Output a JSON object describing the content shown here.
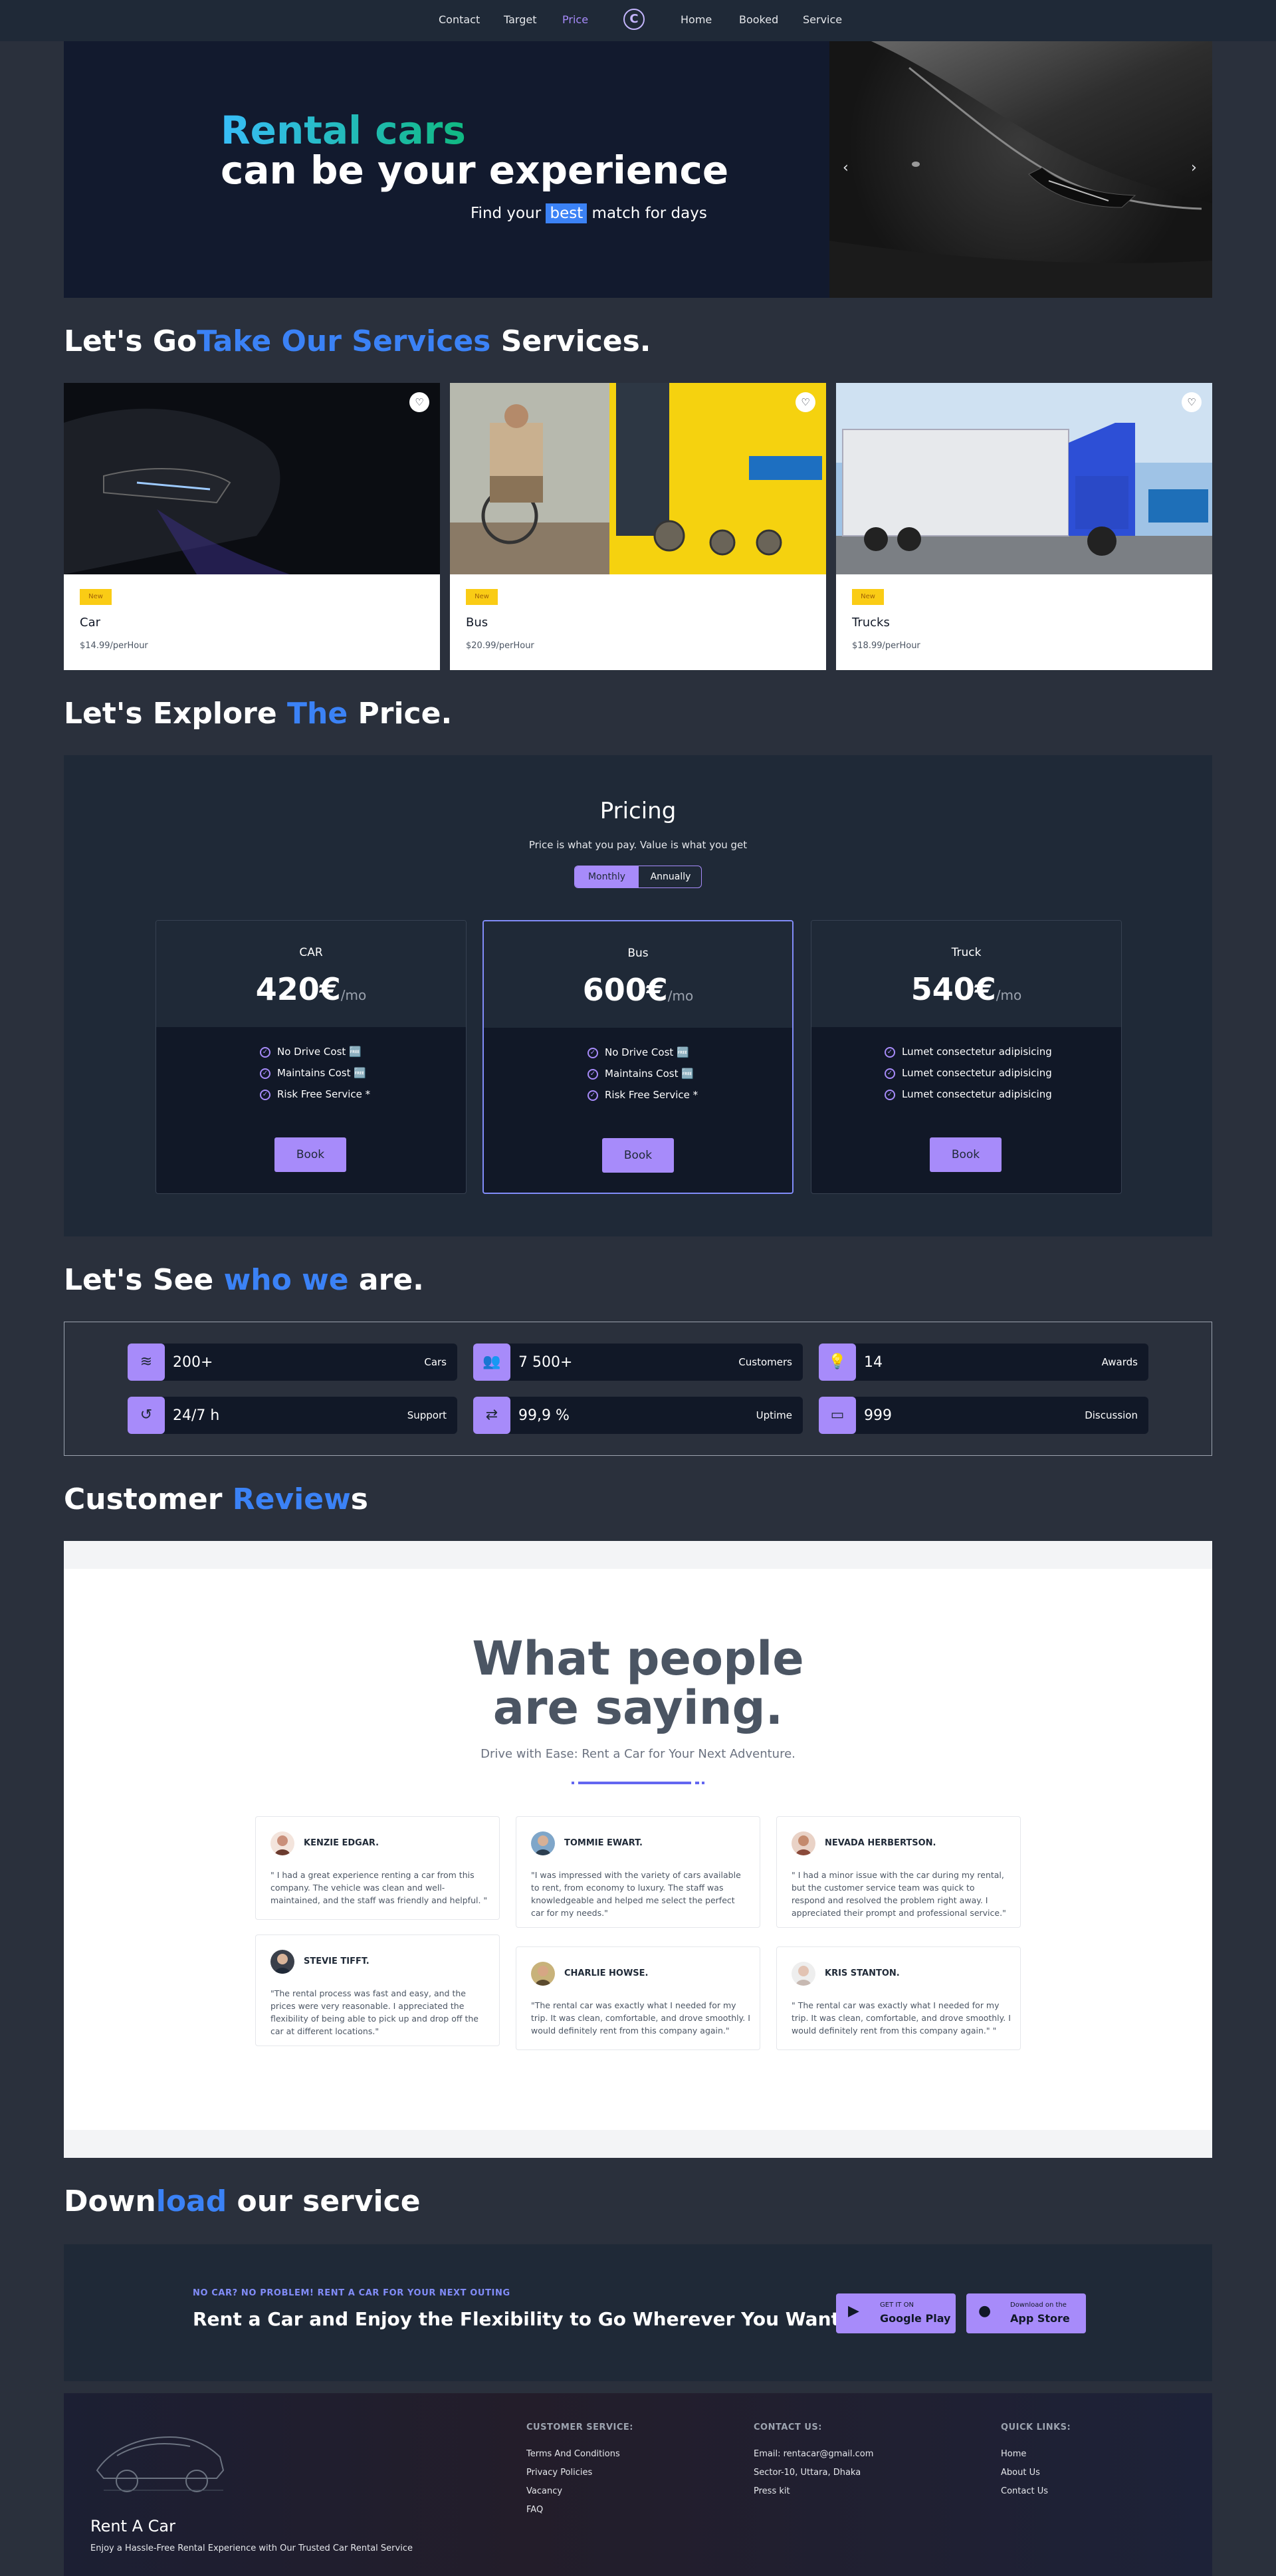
{
  "nav": {
    "left": [
      "Contact",
      "Target",
      "Price"
    ],
    "right": [
      "Home",
      "Booked",
      "Service"
    ],
    "active": "Price",
    "logo": "C"
  },
  "hero": {
    "title_line1": "Rental cars",
    "title_line2": "can be your experience",
    "sub_before": "Find your",
    "sub_highlight": "best",
    "sub_after": "match for days",
    "prev_arrow": "‹",
    "next_arrow": "›"
  },
  "services_section": {
    "title_a": "Let's Go",
    "title_b": "Take Our Services",
    "title_c": " Services.",
    "cards": [
      {
        "badge": "New",
        "name": "Car",
        "price": "$14.99/perHour"
      },
      {
        "badge": "New",
        "name": "Bus",
        "price": "$20.99/perHour"
      },
      {
        "badge": "New",
        "name": "Trucks",
        "price": "$18.99/perHour"
      }
    ],
    "heart": "♡"
  },
  "price_section": {
    "title_a": "Let's Explore ",
    "title_b": "The",
    "title_c": " Price."
  },
  "pricing": {
    "heading": "Pricing",
    "sub": "Price is what you pay. Value is what you get",
    "toggle": [
      "Monthly",
      "Annually"
    ],
    "plans": [
      {
        "name": "CAR",
        "price": "420€",
        "unit": "/mo",
        "features": [
          "No Drive Cost 🆓",
          "Maintains Cost 🆓",
          "Risk Free Service *"
        ],
        "button": "Book"
      },
      {
        "name": "Bus",
        "price": "600€",
        "unit": "/mo",
        "features": [
          "No Drive Cost 🆓",
          "Maintains Cost 🆓",
          "Risk Free Service *"
        ],
        "button": "Book"
      },
      {
        "name": "Truck",
        "price": "540€",
        "unit": "/mo",
        "features": [
          "Lumet consectetur adipisicing",
          "Lumet consectetur adipisicing",
          "Lumet consectetur adipisicing"
        ],
        "button": "Book"
      }
    ]
  },
  "who_section": {
    "title_a": "Let's See ",
    "title_b": "who we",
    "title_c": " are."
  },
  "stats": [
    {
      "icon": "layers-icon",
      "value": "200+",
      "label": "Cars"
    },
    {
      "icon": "users-icon",
      "value": "7 500+",
      "label": "Customers"
    },
    {
      "icon": "lightbulb-icon",
      "value": "14",
      "label": "Awards"
    },
    {
      "icon": "history-icon",
      "value": "24/7 h",
      "label": "Support"
    },
    {
      "icon": "refresh-icon",
      "value": "99,9 %",
      "label": "Uptime"
    },
    {
      "icon": "video-icon",
      "value": "999",
      "label": "Discussion"
    }
  ],
  "reviews_section": {
    "title_a": "Customer ",
    "title_b": "Review",
    "title_c": "s"
  },
  "reviews": {
    "heading_line1": "What people",
    "heading_line2": "are saying.",
    "sub": "Drive with Ease: Rent a Car for Your Next Adventure.",
    "items": [
      {
        "name": "KENZIE EDGAR.",
        "text": "\" I had a great experience renting a car from this company. The vehicle was clean and well-maintained, and the staff was friendly and helpful. \""
      },
      {
        "name": "TOMMIE EWART.",
        "text": "\"I was impressed with the variety of cars available to rent, from economy to luxury. The staff was knowledgeable and helped me select the perfect car for my needs.\""
      },
      {
        "name": "NEVADA HERBERTSON.",
        "text": "\" I had a minor issue with the car during my rental, but the customer service team was quick to respond and resolved the problem right away. I appreciated their prompt and professional service.\""
      },
      {
        "name": "STEVIE TIFFT.",
        "text": "\"The rental process was fast and easy, and the prices were very reasonable. I appreciated the flexibility of being able to pick up and drop off the car at different locations.\""
      },
      {
        "name": "CHARLIE HOWSE.",
        "text": "\"The rental car was exactly what I needed for my trip. It was clean, comfortable, and drove smoothly. I would definitely rent from this company again.\""
      },
      {
        "name": "KRIS STANTON.",
        "text": "\" The rental car was exactly what I needed for my trip. It was clean, comfortable, and drove smoothly. I would definitely rent from this company again.\" \""
      }
    ]
  },
  "download_section": {
    "title_a": "Down",
    "title_b": "load",
    "title_c": " our service"
  },
  "download": {
    "kicker": "NO CAR? NO PROBLEM! RENT A CAR FOR YOUR NEXT OUTING",
    "title": "Rent a Car and Enjoy the Flexibility to Go Wherever You Want",
    "google_small": "GET IT ON",
    "google_big": "Google Play",
    "apple_small": "Download on the",
    "apple_big": "App Store"
  },
  "footer": {
    "brand": "Rent A Car",
    "tagline": "Enjoy a Hassle-Free Rental Experience with Our Trusted Car Rental Service",
    "customer_head": "CUSTOMER SERVICE:",
    "customer_links": [
      "Terms And Conditions",
      "Privacy Policies",
      "Vacancy",
      "FAQ"
    ],
    "contact_head": "CONTACT US:",
    "contact_lines": [
      "Email: rentacar@gmail.com",
      "Sector-10, Uttara, Dhaka",
      "Press kit"
    ],
    "quick_head": "QUICK LINKS:",
    "quick_links": [
      "Home",
      "About Us",
      "Contact Us"
    ]
  },
  "colors": {
    "page_bg": "#2a303c",
    "panel_bg": "#1f2937",
    "accent_purple": "#a78bfa",
    "accent_blue": "#3b82f6",
    "badge_yellow": "#facc15"
  }
}
